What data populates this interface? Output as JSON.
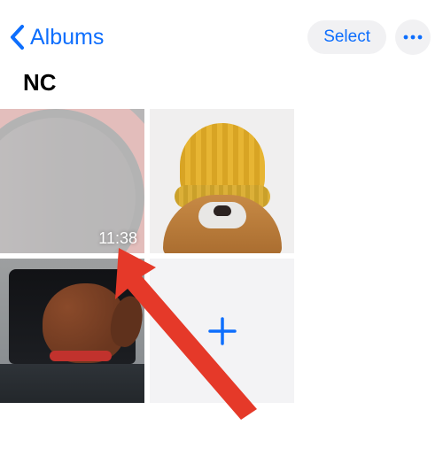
{
  "nav": {
    "back_label": "Albums",
    "select_label": "Select"
  },
  "album": {
    "title": "NC"
  },
  "photos": [
    {
      "type": "video",
      "duration": "11:38"
    },
    {
      "type": "photo"
    },
    {
      "type": "photo"
    }
  ],
  "colors": {
    "accent": "#0d6efd"
  }
}
